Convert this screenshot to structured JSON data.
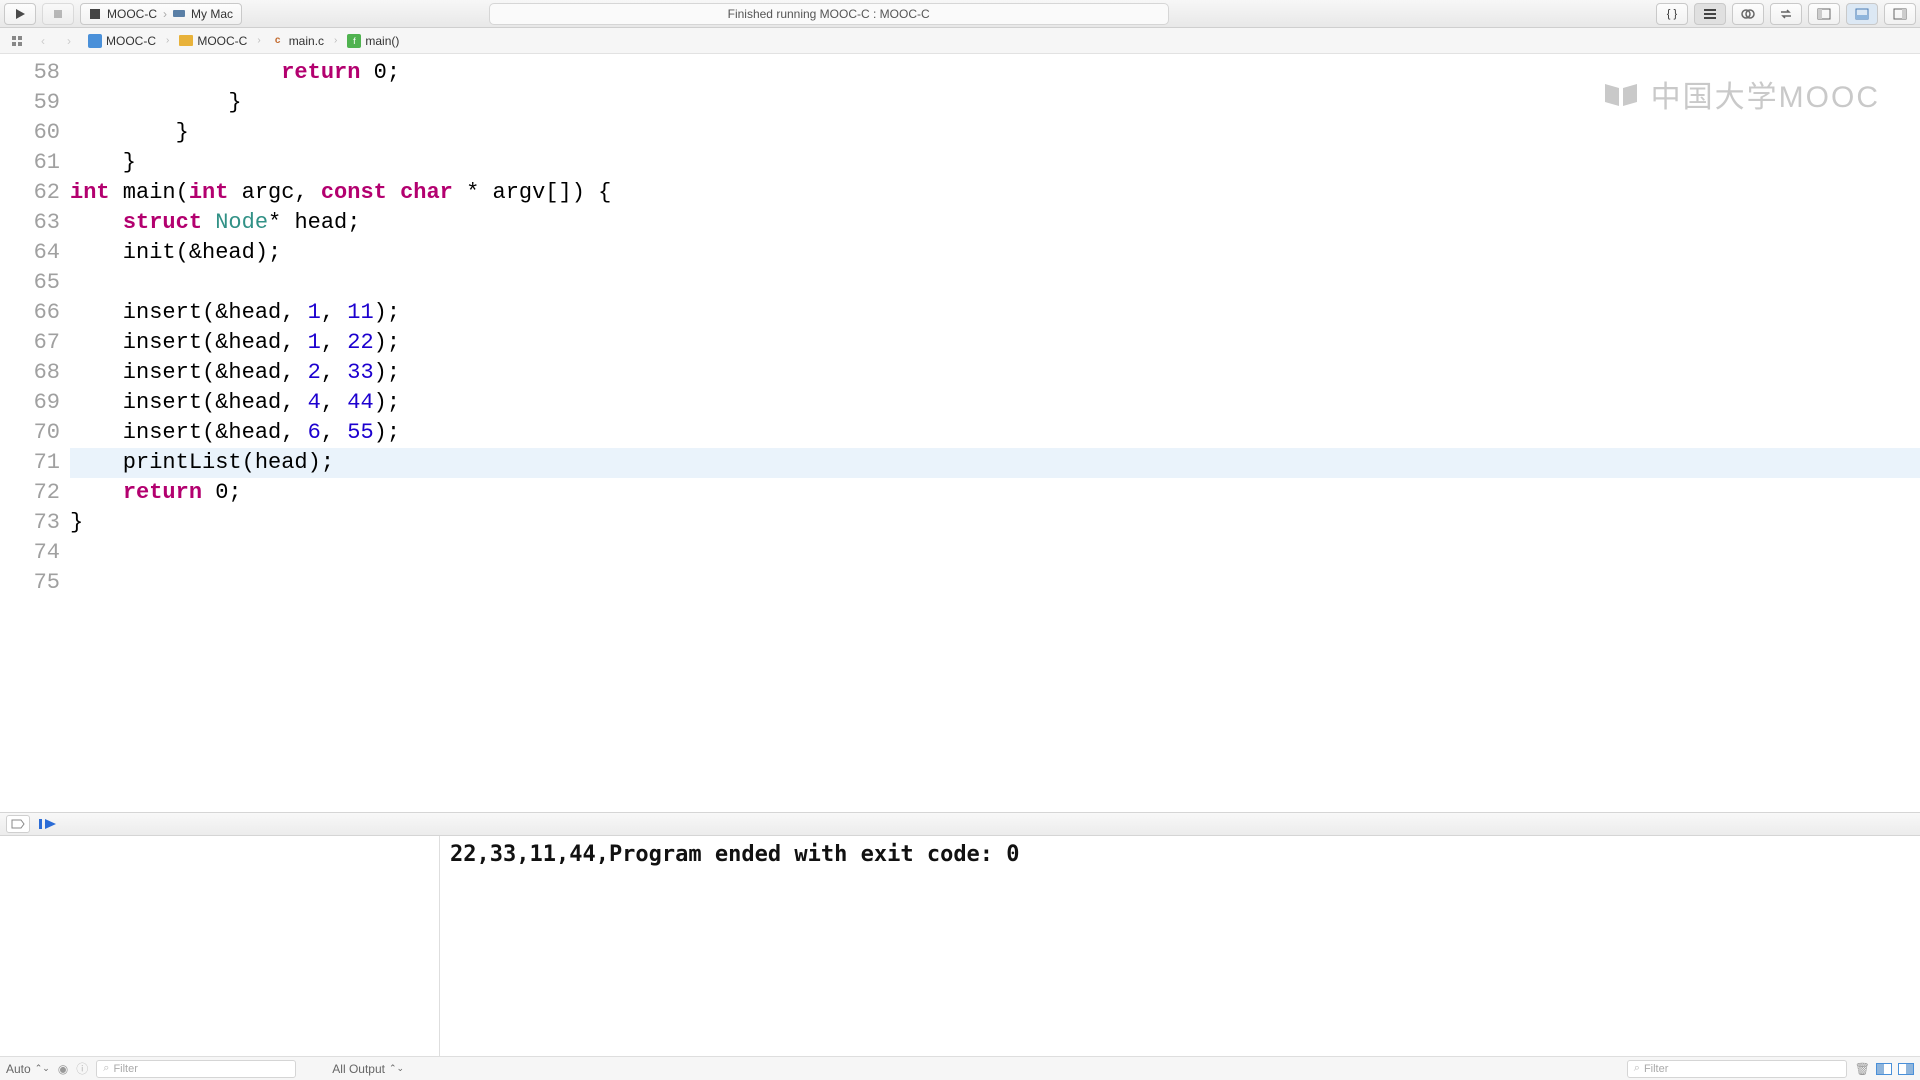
{
  "toolbar": {
    "scheme": "MOOC-C",
    "destination": "My Mac",
    "status": "Finished running MOOC-C : MOOC-C"
  },
  "jumpbar": {
    "crumb1": "MOOC-C",
    "crumb2": "MOOC-C",
    "crumb3": "main.c",
    "crumb4": "main()"
  },
  "watermark": "中国大学MOOC",
  "code": {
    "lines": [
      {
        "n": 58,
        "indent": "                ",
        "kw": "return",
        "rest": " 0;"
      },
      {
        "n": 59,
        "indent": "            ",
        "plain": "}"
      },
      {
        "n": 60,
        "indent": "        ",
        "plain": "}"
      },
      {
        "n": 61,
        "indent": "    ",
        "plain": "}"
      },
      {
        "n": 62,
        "sig": true
      },
      {
        "n": 63,
        "indent": "    ",
        "kw": "struct",
        "type": " Node",
        "rest": "* head;"
      },
      {
        "n": 64,
        "indent": "    ",
        "plain": "init(&head);"
      },
      {
        "n": 65,
        "indent": "",
        "plain": ""
      },
      {
        "n": 66,
        "call": "insert",
        "a1": "1",
        "a2": "11"
      },
      {
        "n": 67,
        "call": "insert",
        "a1": "1",
        "a2": "22"
      },
      {
        "n": 68,
        "call": "insert",
        "a1": "2",
        "a2": "33"
      },
      {
        "n": 69,
        "call": "insert",
        "a1": "4",
        "a2": "44"
      },
      {
        "n": 70,
        "call": "insert",
        "a1": "6",
        "a2": "55"
      },
      {
        "n": 71,
        "indent": "    ",
        "plain": "printList(head);",
        "hl": true
      },
      {
        "n": 72,
        "indent": "    ",
        "kw": "return",
        "rest": " 0;"
      },
      {
        "n": 73,
        "indent": "",
        "plain": "}"
      },
      {
        "n": 74,
        "indent": "",
        "plain": ""
      },
      {
        "n": 75,
        "indent": "",
        "plain": ""
      }
    ],
    "sig": {
      "int": "int",
      "main": " main(",
      "intp": "int",
      "argc": " argc, ",
      "const": "const",
      "char": " char",
      "ptr": " * argv[]) {"
    }
  },
  "console": {
    "output": "22,33,11,44,Program ended with exit code: 0"
  },
  "bottom": {
    "auto": "Auto",
    "filter_left": "Filter",
    "all_output": "All Output",
    "filter_right": "Filter"
  }
}
